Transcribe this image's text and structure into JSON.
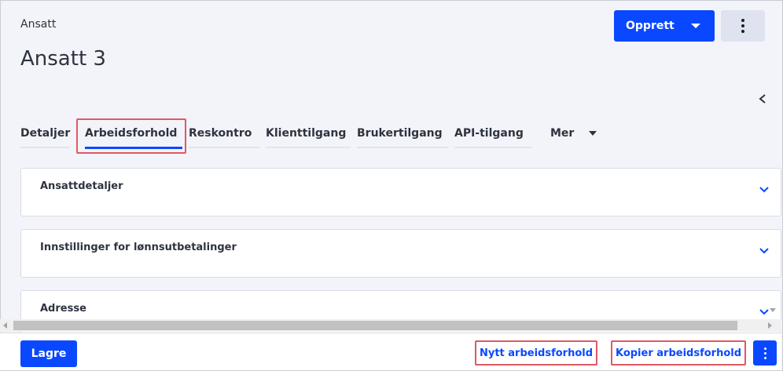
{
  "header": {
    "breadcrumb": "Ansatt",
    "title": "Ansatt 3",
    "create_label": "Opprett"
  },
  "tabs": [
    {
      "label": "Detaljer",
      "active": false
    },
    {
      "label": "Arbeidsforhold",
      "active": true
    },
    {
      "label": "Reskontro",
      "active": false
    },
    {
      "label": "Klienttilgang",
      "active": false
    },
    {
      "label": "Brukertilgang",
      "active": false
    },
    {
      "label": "API-tilgang",
      "active": false
    },
    {
      "label": "Mer",
      "active": false
    }
  ],
  "sections": [
    {
      "title": "Ansattdetaljer"
    },
    {
      "title": "Innstillinger for lønnsutbetalinger"
    },
    {
      "title": "Adresse"
    }
  ],
  "footer": {
    "save_label": "Lagre",
    "new_employment_label": "Nytt arbeidsforhold",
    "copy_employment_label": "Kopier arbeidsforhold"
  },
  "colors": {
    "primary": "#0a48ff",
    "highlight": "#e05862",
    "background": "#f3f4f9"
  },
  "icons": {
    "create_dropdown": "chevron-down-icon",
    "header_menu": "kebab-menu-icon",
    "collapse_panel": "chevron-left-icon",
    "section_toggle": "chevron-down-icon",
    "footer_menu": "kebab-menu-icon"
  }
}
